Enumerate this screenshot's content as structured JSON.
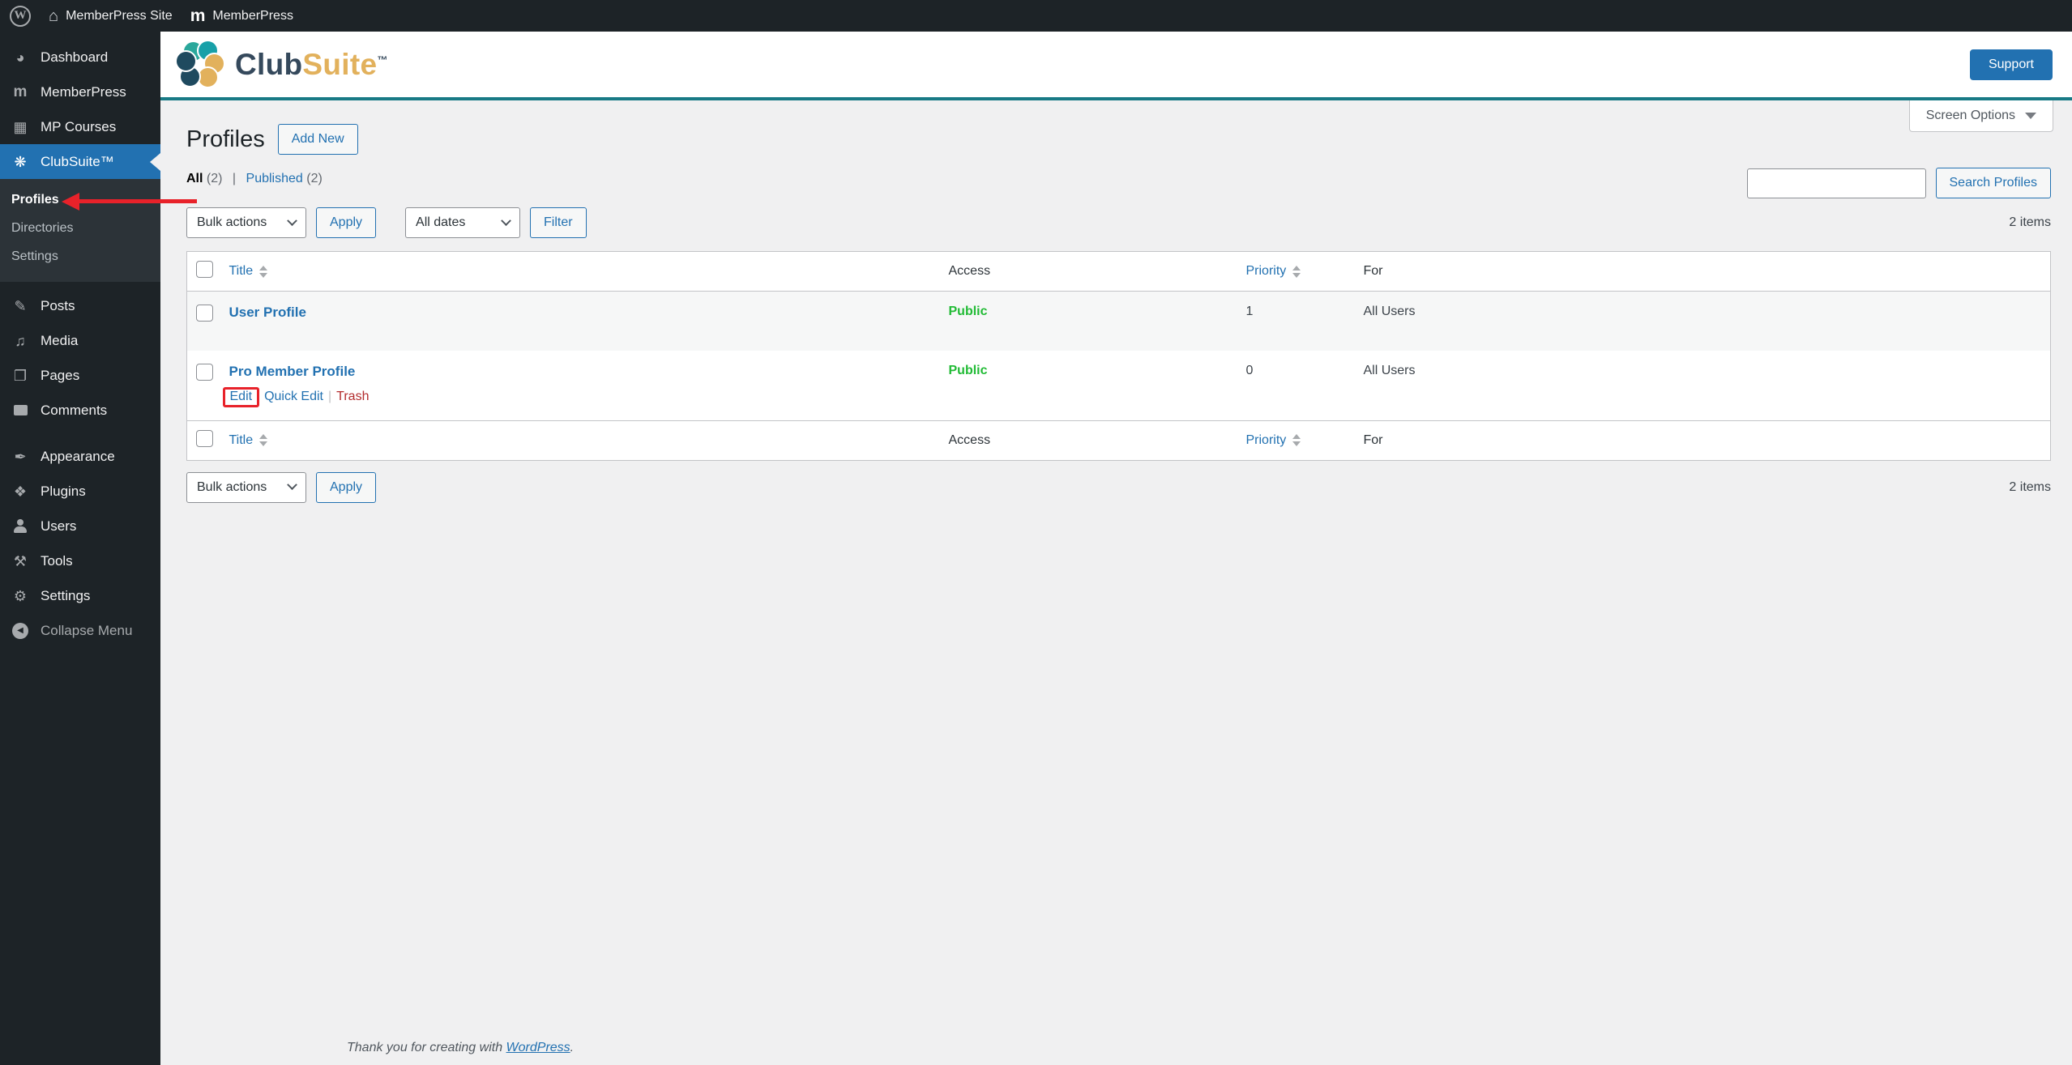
{
  "admin_bar": {
    "site_name": "MemberPress Site",
    "plugin_name": "MemberPress"
  },
  "header": {
    "logo_part1": "Club",
    "logo_part2": "Suite",
    "trademark": "™",
    "support_button": "Support"
  },
  "screen_options": {
    "label": "Screen Options"
  },
  "sidebar": {
    "dashboard": "Dashboard",
    "memberpress": "MemberPress",
    "mp_courses": "MP Courses",
    "clubsuite": "ClubSuite™",
    "submenu": {
      "profiles": "Profiles",
      "directories": "Directories",
      "settings": "Settings"
    },
    "posts": "Posts",
    "media": "Media",
    "pages": "Pages",
    "comments": "Comments",
    "appearance": "Appearance",
    "plugins": "Plugins",
    "users": "Users",
    "tools": "Tools",
    "settings": "Settings",
    "collapse": "Collapse Menu"
  },
  "icons": {
    "dashboard": "◕",
    "memberpress": "m",
    "courses": "▦",
    "clubsuite": "❋",
    "posts": "✎",
    "media": "♫",
    "pages": "❐",
    "appearance": "✒",
    "plugins": "❖",
    "tools": "⚒",
    "settings": "⚙",
    "collapse": "◀",
    "wordpress": "W",
    "home": "⌂"
  },
  "page": {
    "title": "Profiles",
    "add_new_button": "Add New",
    "views": {
      "all_label": "All",
      "all_count": "(2)",
      "separator": "|",
      "published_label": "Published",
      "published_count": "(2)"
    },
    "search": {
      "value": "",
      "button": "Search Profiles"
    },
    "tablenav": {
      "bulk_actions": "Bulk actions",
      "apply_button": "Apply",
      "dates_filter": "All dates",
      "filter_button": "Filter",
      "items_count": "2 items"
    },
    "table": {
      "columns": {
        "title": "Title",
        "access": "Access",
        "priority": "Priority",
        "for": "For"
      },
      "rows": [
        {
          "title": "User Profile",
          "access": "Public",
          "priority": "1",
          "for_value": "All Users"
        },
        {
          "title": "Pro Member Profile",
          "access": "Public",
          "priority": "0",
          "for_value": "All Users"
        }
      ],
      "row_actions": {
        "edit": "Edit",
        "quick_edit": "Quick Edit",
        "trash": "Trash",
        "separator": "|"
      }
    },
    "footer": {
      "text": "Thank you for creating with ",
      "link": "WordPress",
      "suffix": "."
    }
  },
  "colors": {
    "accent_blue": "#2271b1",
    "published_green": "#21bb35",
    "trash_red": "#b32d2e",
    "annotation_red": "#e8222a",
    "brand_teal": "#187a85",
    "brand_gold": "#e2b15c",
    "brand_navy": "#35495c"
  }
}
